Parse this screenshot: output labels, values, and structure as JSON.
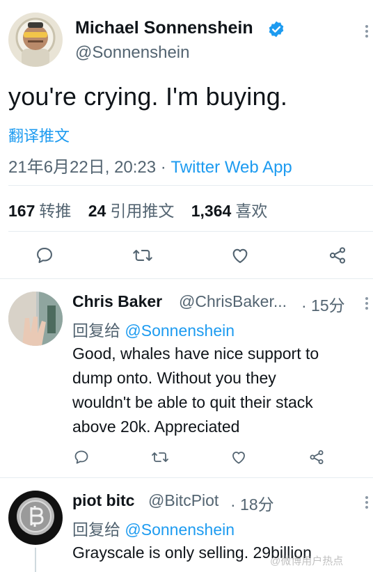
{
  "main_tweet": {
    "author_name": "Michael Sonnenshein",
    "handle": "@Sonnenshein",
    "text": "you're crying. I'm buying.",
    "translate_label": "翻译推文",
    "timestamp": "21年6月22日, 20:23 · ",
    "source": "Twitter Web App",
    "stats": [
      {
        "count": "167",
        "label": "转推"
      },
      {
        "count": "24",
        "label": "引用推文"
      },
      {
        "count": "1,364",
        "label": "喜欢"
      }
    ]
  },
  "replies": [
    {
      "author_name": "Chris Baker",
      "handle": "@ChrisBaker...",
      "time": " · 15分",
      "reply_prefix": "回复给 ",
      "reply_to": "@Sonnenshein",
      "text_lines": [
        "Good, whales have nice support to",
        "dump onto. Without you they",
        "wouldn't be able to quit their stack",
        "above 20k. Appreciated"
      ]
    },
    {
      "author_name": "piot bitc",
      "handle": "@BitcPiot",
      "time": " · 18分",
      "reply_prefix": "回复给 ",
      "reply_to": "@Sonnenshein",
      "text_lines": [
        "Grayscale is only selling. 29billion"
      ]
    }
  ],
  "watermark": "@微博用户热点"
}
